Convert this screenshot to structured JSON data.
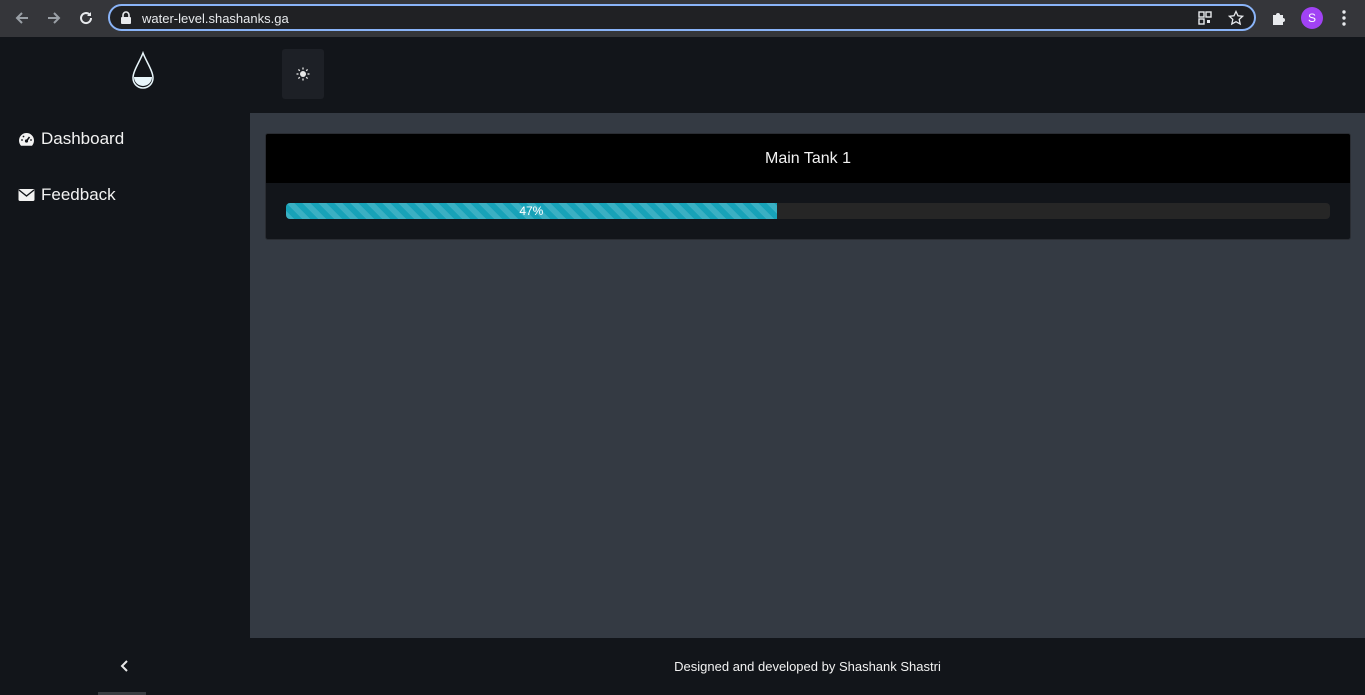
{
  "browser": {
    "url": "water-level.shashanks.ga",
    "profile_initial": "S",
    "profile_color": "#a142f4",
    "accent": "#8ab4f8"
  },
  "icons": {
    "back": "back-arrow-icon",
    "forward": "forward-arrow-icon",
    "reload": "reload-icon",
    "lock": "lock-icon",
    "qr": "qr-code-icon",
    "star": "star-icon",
    "extensions": "puzzle-icon",
    "menu": "more-vert-icon",
    "logo": "water-drop-icon",
    "theme": "sun-icon",
    "dashboard": "tachometer-icon",
    "feedback": "envelope-icon",
    "collapse": "chevron-left-icon"
  },
  "sidebar": {
    "items": [
      {
        "label": "Dashboard"
      },
      {
        "label": "Feedback"
      }
    ]
  },
  "tanks": [
    {
      "title": "Main Tank 1",
      "level_percent": 47,
      "level_label": "47%",
      "bar_color": "#17a2b8"
    }
  ],
  "footer": {
    "text": "Designed and developed by Shashank Shastri"
  }
}
